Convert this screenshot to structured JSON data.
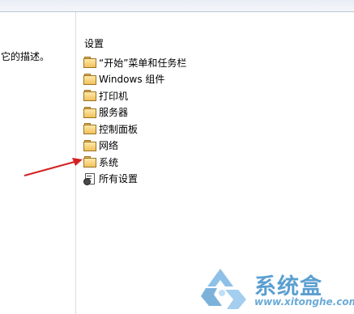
{
  "left_pane": {
    "description_text": "它的描述。"
  },
  "right_pane": {
    "column_header": "设置",
    "items": [
      {
        "label": "“开始”菜单和任务栏",
        "icon": "folder-icon"
      },
      {
        "label": "Windows 组件",
        "icon": "folder-icon"
      },
      {
        "label": "打印机",
        "icon": "folder-icon"
      },
      {
        "label": "服务器",
        "icon": "folder-icon"
      },
      {
        "label": "控制面板",
        "icon": "folder-icon"
      },
      {
        "label": "网络",
        "icon": "folder-icon"
      },
      {
        "label": "系统",
        "icon": "folder-icon"
      },
      {
        "label": "所有设置",
        "icon": "settings-icon"
      }
    ]
  },
  "annotation": {
    "arrow_color": "#d42020",
    "points_to": "系统"
  },
  "watermark": {
    "title": "系统盒",
    "url": "www.xitonghe.com",
    "color": "#5b9fd1"
  }
}
